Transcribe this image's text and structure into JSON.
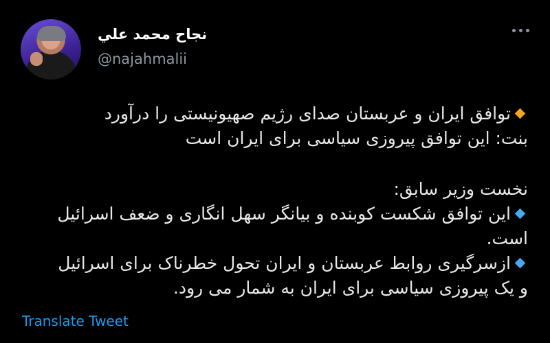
{
  "tweet": {
    "author_name": "نجاح محمد علي",
    "author_handle": "@najahmalii",
    "lines": [
      "توافق ایران و عربستان صدای رژیم صهیونیستی را درآورد",
      "بنت: این توافق پیروزی سیاسی برای ایران است",
      "نخست وزیر سابق:",
      "این توافق شکست کوبنده و بیانگر سهل انگاری و ضعف اسرائیل",
      "است.",
      "ازسرگیری روابط عربستان و ایران تحول خطرناک برای اسرائیل",
      "و یک پیروزی سیاسی برای ایران به شمار می رود."
    ],
    "translate_label": "Translate Tweet"
  },
  "icons": {
    "bullet_orange": "orange-diamond-icon",
    "bullet_blue": "blue-diamond-icon",
    "more": "more-icon"
  },
  "colors": {
    "background": "#000000",
    "text": "#e7e9ea",
    "secondary": "#8b98a5",
    "link": "#1d9bf0",
    "orange_bullet": "#f4a623",
    "blue_bullet": "#4aa8f0"
  }
}
